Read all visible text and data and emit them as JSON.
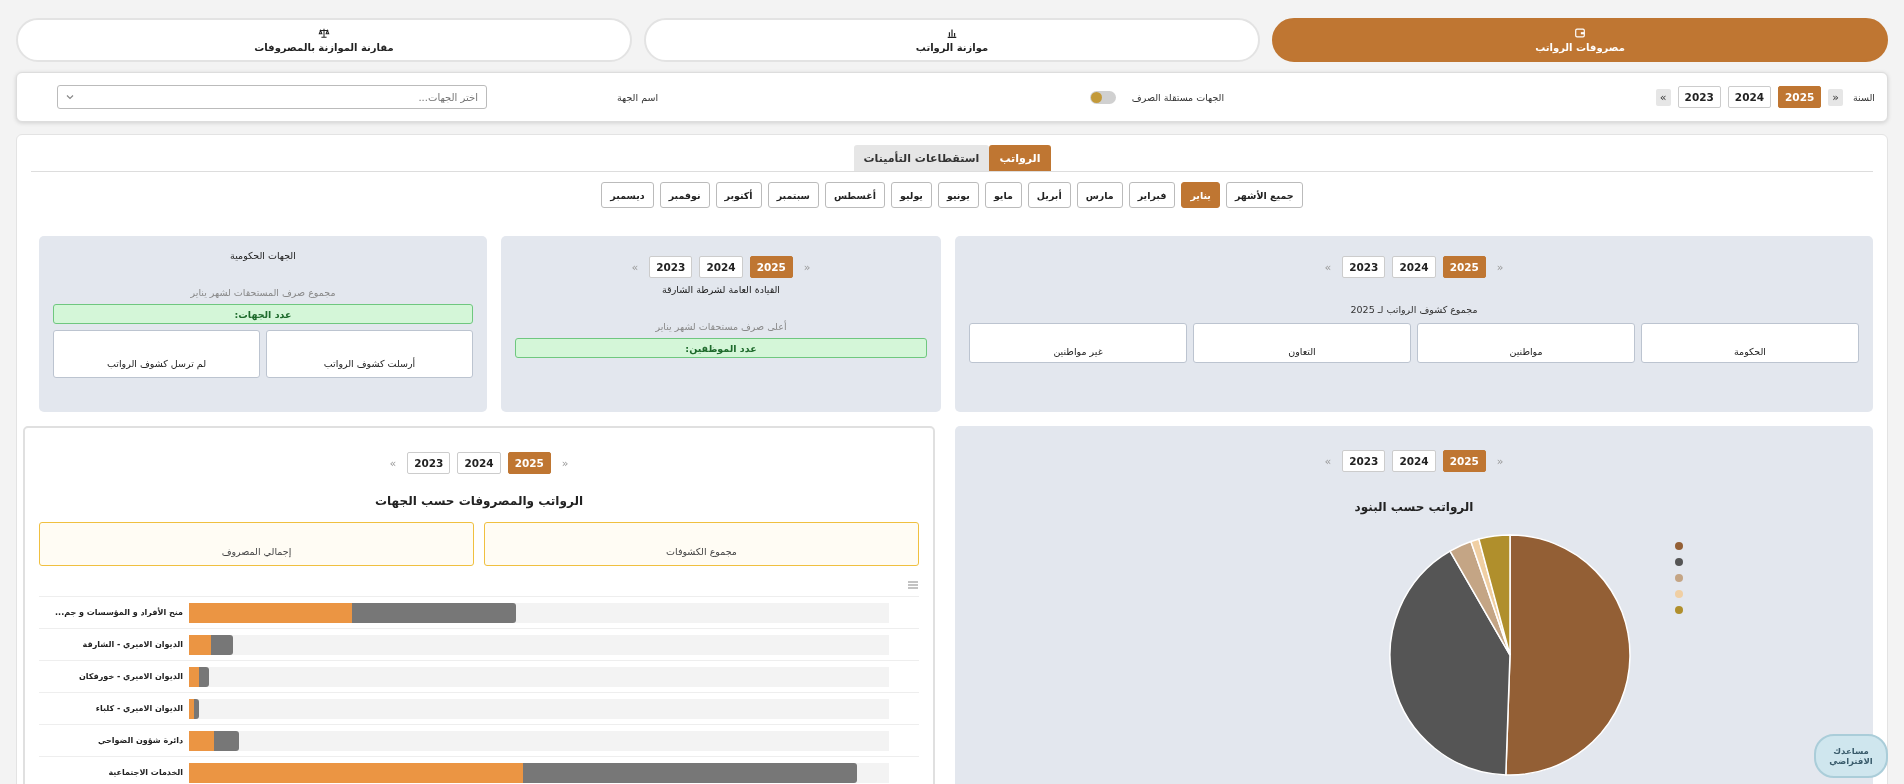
{
  "top_tabs": [
    {
      "label": "مصروفات الرواتب",
      "kind": "wallet",
      "selected": true
    },
    {
      "label": "موازنة الرواتب",
      "kind": "chart",
      "selected": false
    },
    {
      "label": "مقارنة الموازنة بالمصروفات",
      "kind": "scale",
      "selected": false
    }
  ],
  "filter_bar": {
    "year_label": "السنة",
    "years": {
      "prev": "«",
      "options": [
        {
          "label": "2025",
          "selected": true
        },
        {
          "label": "2024",
          "selected": false
        },
        {
          "label": "2023",
          "selected": false
        }
      ],
      "next": "»"
    },
    "toggle_label": "الجهات مستقلة الصرف",
    "toggle_on": false,
    "entity_label": "اسم الجهة",
    "entity_select": {
      "placeholder": "اختر الجهات..."
    }
  },
  "sub_tabs": [
    {
      "label": "الرواتب",
      "selected": true
    },
    {
      "label": "استقطاعات التأمينات",
      "selected": false
    }
  ],
  "months": [
    {
      "label": "جميع الأشهر",
      "selected": false
    },
    {
      "label": "يناير",
      "selected": true
    },
    {
      "label": "فبراير",
      "selected": false
    },
    {
      "label": "مارس",
      "selected": false
    },
    {
      "label": "أبريل",
      "selected": false
    },
    {
      "label": "مايو",
      "selected": false
    },
    {
      "label": "يونيو",
      "selected": false
    },
    {
      "label": "يوليو",
      "selected": false
    },
    {
      "label": "أغسطس",
      "selected": false
    },
    {
      "label": "سبتمبر",
      "selected": false
    },
    {
      "label": "أكتوبر",
      "selected": false
    },
    {
      "label": "نوفمبر",
      "selected": false
    },
    {
      "label": "ديسمبر",
      "selected": false
    }
  ],
  "payroll_card": {
    "years": {
      "prev": "«",
      "options": [
        {
          "label": "2025",
          "selected": true
        },
        {
          "label": "2024",
          "selected": false
        },
        {
          "label": "2023",
          "selected": false
        }
      ],
      "next": "»"
    },
    "caption": "مجموع كشوف الرواتب لـ 2025",
    "stats": [
      "الحكومة",
      "مواطنين",
      "التعاون",
      "غير مواطنين"
    ]
  },
  "top_entity_card": {
    "years": {
      "prev": "«",
      "options": [
        {
          "label": "2025",
          "selected": true
        },
        {
          "label": "2024",
          "selected": false
        },
        {
          "label": "2023",
          "selected": false
        }
      ],
      "next": "»"
    },
    "title": "القيادة العامة لشرطة الشارقة",
    "caption": "أعلى صرف مستحقات لشهر يناير",
    "badge": "عدد الموظفين:"
  },
  "entities_card": {
    "title": "الجهات الحكومية",
    "caption": "مجموع صرف المستحقات لشهر يناير",
    "badge": "عدد الجهات:",
    "stats": [
      "أرسلت كشوف الرواتب",
      "لم ترسل كشوف الرواتب"
    ]
  },
  "items_chart_card": {
    "years": {
      "prev": "«",
      "options": [
        {
          "label": "2025",
          "selected": true
        },
        {
          "label": "2024",
          "selected": false
        },
        {
          "label": "2023",
          "selected": false
        }
      ],
      "next": "»"
    },
    "title": "الرواتب حسب البنود",
    "legend": [
      {
        "color": "#935f35"
      },
      {
        "color": "#555555"
      },
      {
        "color": "#c4a585"
      },
      {
        "color": "#f0cfa3"
      },
      {
        "color": "#b08f2c"
      }
    ]
  },
  "entities_chart_card": {
    "years": {
      "prev": "«",
      "options": [
        {
          "label": "2025",
          "selected": true
        },
        {
          "label": "2024",
          "selected": false
        },
        {
          "label": "2023",
          "selected": false
        }
      ],
      "next": "»"
    },
    "title": "الرواتب والمصروفات حسب الجهات",
    "summaries": [
      "مجموع الكشوفات",
      "إجمالي المصروف"
    ],
    "rows": [
      {
        "label": "منح الأفراد و المؤسسات و جم...",
        "level": 0.467
      },
      {
        "label": "الديوان الاميري - الشارقة",
        "level": 0.063
      },
      {
        "label": "الديوان الاميري - خورفكان",
        "level": 0.028
      },
      {
        "label": "الديوان الاميري - كلباء",
        "level": 0.014
      },
      {
        "label": "دائرة شؤون الضواحي",
        "level": 0.072
      },
      {
        "label": "الخدمات الاجتماعية",
        "level": 0.954
      }
    ]
  },
  "assistant": {
    "label": "مساعدك الافتراضي"
  }
}
